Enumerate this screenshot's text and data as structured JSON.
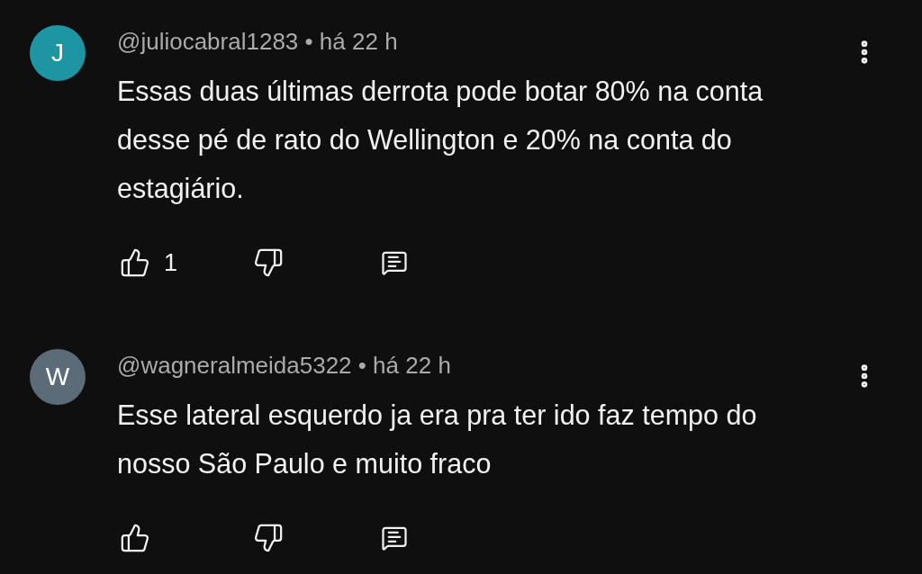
{
  "comments": [
    {
      "avatar_letter": "J",
      "color": "#1e95a3",
      "meta": "@juliocabral1283 • há 22 h",
      "text": "Essas duas últimas derrota pode botar 80% na conta desse pé de rato do Wellington e 20% na conta do estagiário.",
      "likes": "1"
    },
    {
      "avatar_letter": "W",
      "color": "#5b6b78",
      "meta": "@wagneralmeida5322 • há 22 h",
      "text": "Esse lateral esquerdo ja era pra ter ido faz tempo do nosso São Paulo e muito fraco"
    }
  ]
}
